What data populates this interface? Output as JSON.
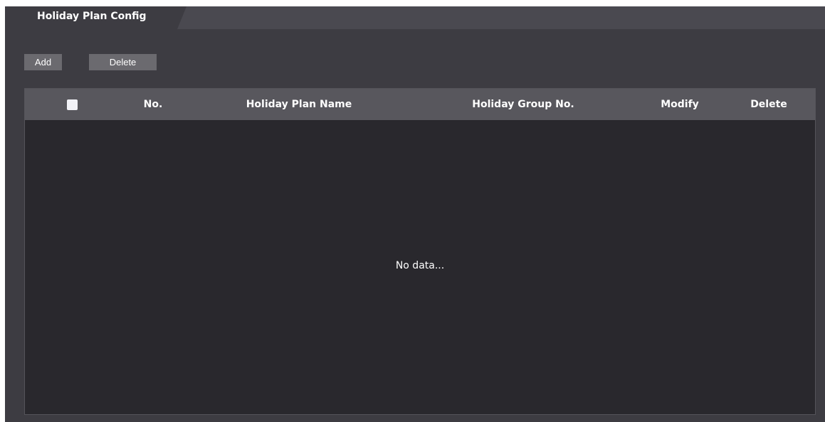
{
  "tab": {
    "title": "Holiday Plan Config"
  },
  "toolbar": {
    "add_label": "Add",
    "delete_label": "Delete"
  },
  "table": {
    "columns": [
      "",
      "No.",
      "Holiday Plan Name",
      "Holiday Group No.",
      "Modify",
      "Delete"
    ],
    "rows": [],
    "empty_text": "No data..."
  },
  "colors": {
    "panel_bg": "#3d3c42",
    "tab_strip_bg": "#4a4950",
    "header_bg": "#58575d",
    "body_bg": "#29282d",
    "button_bg": "#6b6a6f"
  }
}
